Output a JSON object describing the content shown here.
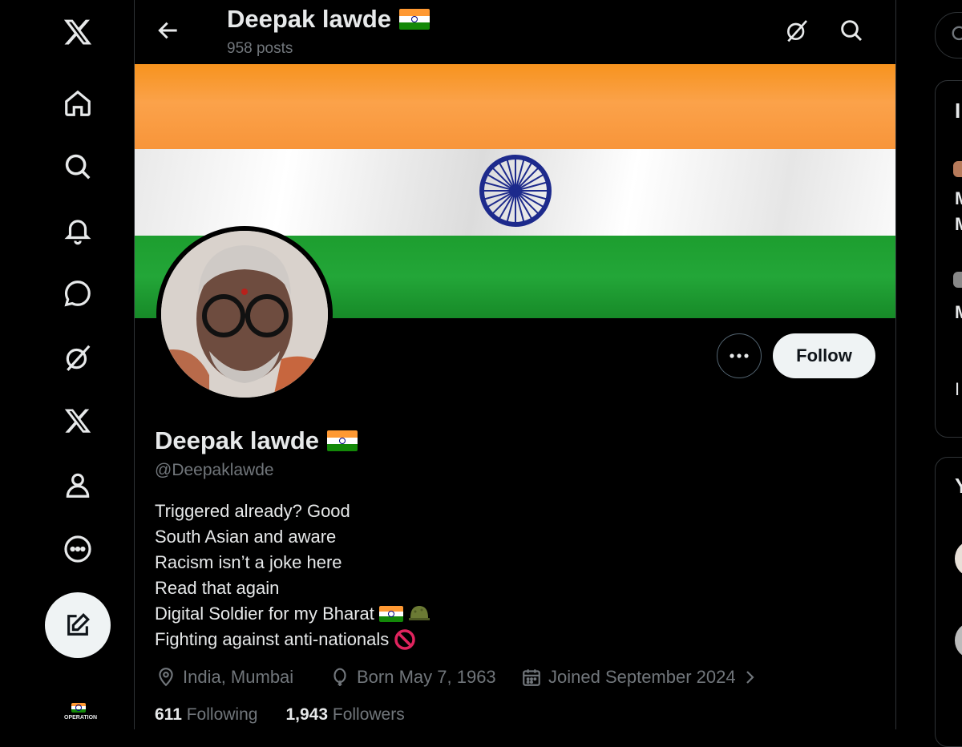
{
  "nav": {
    "items": [
      "x-logo",
      "home",
      "explore",
      "notifications",
      "messages",
      "grok",
      "premium",
      "profile",
      "more"
    ],
    "compose_label": "Post",
    "operation_badge": "OPERATION"
  },
  "header": {
    "name": "Deepak lawde",
    "posts": "958 posts"
  },
  "profile": {
    "name": "Deepak lawde",
    "handle": "@Deepaklawde",
    "follow_label": "Follow",
    "bio": [
      "Triggered already? Good",
      "South Asian and aware",
      "Racism isn’t a joke here",
      "Read that again",
      "Digital Soldier for my Bharat",
      "Fighting against anti-nationals"
    ],
    "location": "India, Mumbai",
    "born": "Born May 7, 1963",
    "joined": "Joined September 2024",
    "following_count": "611",
    "following_label": "Following",
    "followers_count": "1,943",
    "followers_label": "Followers"
  },
  "right_column": {
    "fragments": [
      "I",
      "M",
      "M",
      "M",
      "I",
      "Y"
    ]
  },
  "colors": {
    "background": "#000000",
    "text": "#e7e9ea",
    "muted": "#71767b",
    "saffron": "#ff9933",
    "green": "#138808",
    "chakra": "#000080"
  }
}
